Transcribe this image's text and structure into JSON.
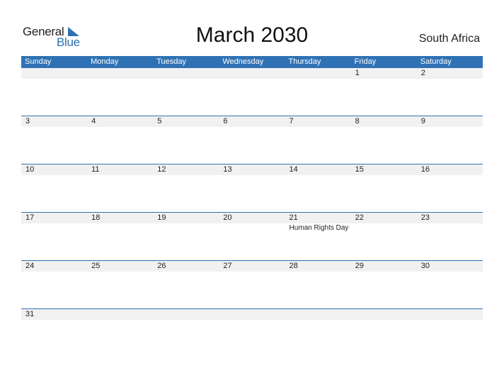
{
  "logo": {
    "general": "General",
    "blue": "Blue"
  },
  "title": "March 2030",
  "country": "South Africa",
  "colors": {
    "accent": "#2f72b4",
    "strip": "#f1f1f1"
  },
  "weekdays": [
    "Sunday",
    "Monday",
    "Tuesday",
    "Wednesday",
    "Thursday",
    "Friday",
    "Saturday"
  ],
  "weeks": [
    {
      "days": [
        "",
        "",
        "",
        "",
        "",
        "1",
        "2"
      ],
      "events": [
        "",
        "",
        "",
        "",
        "",
        "",
        ""
      ]
    },
    {
      "days": [
        "3",
        "4",
        "5",
        "6",
        "7",
        "8",
        "9"
      ],
      "events": [
        "",
        "",
        "",
        "",
        "",
        "",
        ""
      ]
    },
    {
      "days": [
        "10",
        "11",
        "12",
        "13",
        "14",
        "15",
        "16"
      ],
      "events": [
        "",
        "",
        "",
        "",
        "",
        "",
        ""
      ]
    },
    {
      "days": [
        "17",
        "18",
        "19",
        "20",
        "21",
        "22",
        "23"
      ],
      "events": [
        "",
        "",
        "",
        "",
        "Human Rights Day",
        "",
        ""
      ]
    },
    {
      "days": [
        "24",
        "25",
        "26",
        "27",
        "28",
        "29",
        "30"
      ],
      "events": [
        "",
        "",
        "",
        "",
        "",
        "",
        ""
      ]
    },
    {
      "days": [
        "31",
        "",
        "",
        "",
        "",
        "",
        ""
      ],
      "events": [
        "",
        "",
        "",
        "",
        "",
        "",
        ""
      ]
    }
  ]
}
